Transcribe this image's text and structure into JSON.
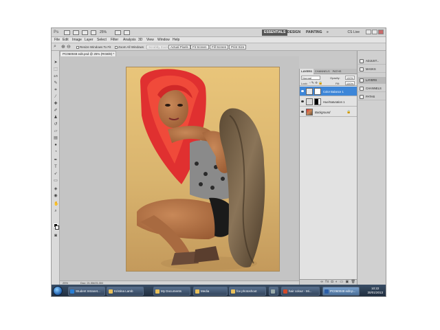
{
  "appbar": {
    "logo": "Ps",
    "zoom": "25%",
    "workspaces": [
      "ESSENTIALS",
      "DESIGN",
      "PAINTING"
    ],
    "more": "»",
    "cslive": "CS Live"
  },
  "menu": [
    "File",
    "Edit",
    "Image",
    "Layer",
    "Select",
    "Filter",
    "Analysis",
    "3D",
    "View",
    "Window",
    "Help"
  ],
  "options": {
    "resize_windows": "Resize Windows To Fit",
    "zoom_all": "Zoom All Windows",
    "scrubby_zoom": "Scrubby Zoom",
    "actual_pixels": "Actual Pixels",
    "fit_screen": "Fit Screen",
    "fill_screen": "Fill Screen",
    "print_size": "Print Size"
  },
  "document": {
    "tab_title": "PC060048 edit.psd @ 25% (RGB/8) *"
  },
  "status": {
    "zoom": "25%",
    "doc": "Doc: 21.0M/21.0M"
  },
  "layers_panel": {
    "tabs": [
      "LAYERS",
      "CHANNELS",
      "PATHS"
    ],
    "blend_mode": "Normal",
    "opacity_label": "Opacity:",
    "opacity_value": "100%",
    "lock_label": "Lock:",
    "fill_label": "Fill:",
    "fill_value": "100%",
    "layers": [
      {
        "name": "Color Balance 1",
        "active": true
      },
      {
        "name": "Hue/Saturation 1",
        "active": false
      },
      {
        "name": "Background",
        "active": false
      }
    ],
    "footer_icons": "∞ fx ◘ ◐ ▭ ▣ 🗑"
  },
  "dock": {
    "items": [
      "ADJUST...",
      "MASKS",
      "LAYERS",
      "CHANNELS",
      "PATHS"
    ]
  },
  "taskbar": {
    "items": [
      {
        "label": "Student Intranet...",
        "color": "#2a7fd4"
      },
      {
        "label": "Kristina Lamb",
        "color": "#e8c05a"
      },
      {
        "label": "My Documents",
        "color": "#e8c05a"
      },
      {
        "label": "Media",
        "color": "#e8c05a"
      },
      {
        "label": "fox photoshoot",
        "color": "#e8c05a"
      },
      {
        "label": "",
        "color": "#9aa"
      },
      {
        "label": "hair colour - Mi...",
        "color": "#d24a2a"
      },
      {
        "label": "PC060048 edit.p...",
        "color": "#2b5ea8"
      }
    ],
    "time": "10:22",
    "date": "30/01/2013"
  }
}
